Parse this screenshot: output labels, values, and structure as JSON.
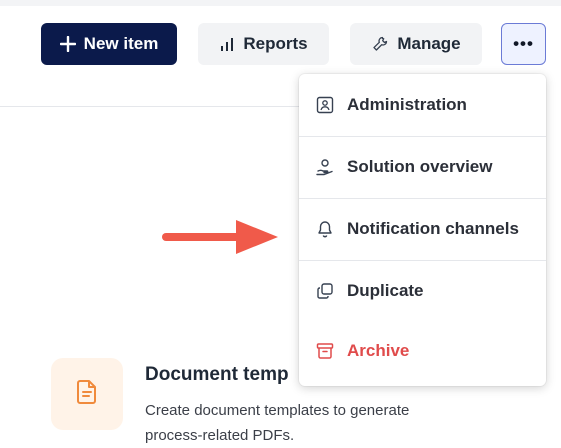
{
  "toolbar": {
    "new_item_label": "New item",
    "reports_label": "Reports",
    "manage_label": "Manage",
    "more_label": "•••"
  },
  "menu": {
    "items": [
      {
        "label": "Administration",
        "icon": "user-badge-icon"
      },
      {
        "label": "Solution overview",
        "icon": "solution-overview-icon"
      },
      {
        "label": "Notification channels",
        "icon": "bell-icon"
      },
      {
        "label": "Duplicate",
        "icon": "duplicate-icon"
      },
      {
        "label": "Archive",
        "icon": "archive-icon"
      }
    ]
  },
  "card": {
    "title": "Document temp",
    "description": "Create document templates to generate process-related PDFs.",
    "icon": "document-icon"
  },
  "colors": {
    "primary": "#0b1a4b",
    "danger": "#e04b4b",
    "arrow": "#f05a4a",
    "card_icon_bg": "#fff3e8",
    "card_icon": "#f08a3c"
  }
}
